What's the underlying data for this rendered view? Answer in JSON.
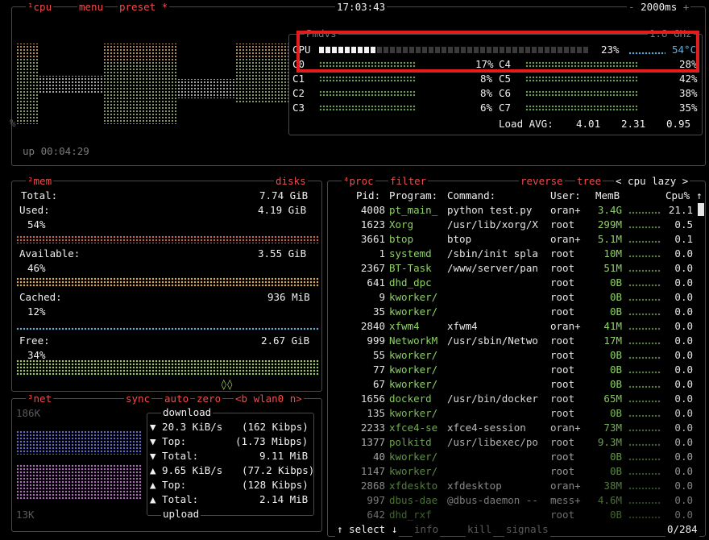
{
  "top": {
    "cpu_tag": "¹cpu",
    "menu": "menu",
    "preset": "preset *",
    "clock": "17:03:43",
    "interval": "2000ms",
    "minus": "-",
    "plus": "+"
  },
  "cpu": {
    "model": "Pmdvs",
    "freq": "1.8 GHz",
    "total_label": "CPU",
    "total_pct": "23%",
    "temp": "54°C",
    "cores": [
      {
        "name": "C0",
        "pct": "17%"
      },
      {
        "name": "C1",
        "pct": "8%"
      },
      {
        "name": "C2",
        "pct": "8%"
      },
      {
        "name": "C3",
        "pct": "6%"
      },
      {
        "name": "C4",
        "pct": "28%"
      },
      {
        "name": "C5",
        "pct": "42%"
      },
      {
        "name": "C6",
        "pct": "38%"
      },
      {
        "name": "C7",
        "pct": "35%"
      }
    ],
    "load_label": "Load AVG:",
    "load": [
      "4.01",
      "2.31",
      "0.95"
    ],
    "uptime": "up 00:04:29",
    "pct_marker": "%"
  },
  "mem": {
    "tag": "²mem",
    "disks": "disks",
    "total_label": "Total:",
    "total": "7.74 GiB",
    "used_label": "Used:",
    "used": "4.19 GiB",
    "used_pct": "54%",
    "avail_label": "Available:",
    "avail": "3.55 GiB",
    "avail_pct": "46%",
    "cached_label": "Cached:",
    "cached": "936 MiB",
    "cached_pct": "12%",
    "free_label": "Free:",
    "free": "2.67 GiB",
    "free_pct": "34%"
  },
  "net": {
    "tag": "³net",
    "sync": "sync",
    "auto": "auto",
    "zero": "zero",
    "iface": "<b wlan0 n>",
    "scale_top": "186K",
    "scale_bottom": "13K",
    "download": "download",
    "upload": "upload",
    "down_rate": "▼ 20.3 KiB/s",
    "down_rate_b": "(162 Kibps)",
    "down_top_l": "▼ Top:",
    "down_top": "(1.73 Mibps)",
    "down_total_l": "▼ Total:",
    "down_total": "9.11 MiB",
    "up_rate": "▲ 9.65 KiB/s",
    "up_rate_b": "(77.2 Kibps)",
    "up_top_l": "▲ Top:",
    "up_top": "(128 Kibps)",
    "up_total_l": "▲ Total:",
    "up_total": "2.14 MiB"
  },
  "proc": {
    "tag": "⁴proc",
    "filter": "filter",
    "reverse": "reverse",
    "tree": "tree",
    "sort": "< cpu lazy >",
    "headers": [
      "Pid:",
      "Program:",
      "Command:",
      "User:",
      "MemB",
      "Cpu%"
    ],
    "sort_arrow": "↑",
    "rows": [
      [
        "4008",
        "pt_main_",
        "python test.py",
        "oran+",
        "3.4G",
        "21.1"
      ],
      [
        "1623",
        "Xorg",
        "/usr/lib/xorg/X",
        "root",
        "299M",
        "0.5"
      ],
      [
        "3661",
        "btop",
        "btop",
        "oran+",
        "5.1M",
        "0.1"
      ],
      [
        "1",
        "systemd",
        "/sbin/init spla",
        "root",
        "10M",
        "0.0"
      ],
      [
        "2367",
        "BT-Task",
        "/www/server/pan",
        "root",
        "51M",
        "0.0"
      ],
      [
        "641",
        "dhd_dpc",
        "",
        "root",
        "0B",
        "0.0"
      ],
      [
        "9",
        "kworker/",
        "",
        "root",
        "0B",
        "0.0"
      ],
      [
        "35",
        "kworker/",
        "",
        "root",
        "0B",
        "0.0"
      ],
      [
        "2840",
        "xfwm4",
        "xfwm4",
        "oran+",
        "41M",
        "0.0"
      ],
      [
        "999",
        "NetworkM",
        "/usr/sbin/Netwo",
        "root",
        "17M",
        "0.0"
      ],
      [
        "55",
        "kworker/",
        "",
        "root",
        "0B",
        "0.0"
      ],
      [
        "77",
        "kworker/",
        "",
        "root",
        "0B",
        "0.0"
      ],
      [
        "67",
        "kworker/",
        "",
        "root",
        "0B",
        "0.0"
      ],
      [
        "1656",
        "dockerd",
        "/usr/bin/docker",
        "root",
        "65M",
        "0.0"
      ],
      [
        "135",
        "kworker/",
        "",
        "root",
        "0B",
        "0.0"
      ],
      [
        "2233",
        "xfce4-se",
        "xfce4-session",
        "oran+",
        "73M",
        "0.0"
      ],
      [
        "1377",
        "polkitd",
        "/usr/libexec/po",
        "root",
        "9.3M",
        "0.0"
      ],
      [
        "40",
        "kworker/",
        "",
        "root",
        "0B",
        "0.0"
      ],
      [
        "1147",
        "kworker/",
        "",
        "root",
        "0B",
        "0.0"
      ],
      [
        "2868",
        "xfdeskto",
        "xfdesktop",
        "oran+",
        "38M",
        "0.0"
      ],
      [
        "997",
        "dbus-dae",
        "@dbus-daemon --",
        "mess+",
        "4.6M",
        "0.0"
      ],
      [
        "642",
        "dhd_rxf",
        "",
        "root",
        "0B",
        "0.0"
      ]
    ],
    "footer": {
      "select": "↑ select ↓",
      "info": "info",
      "kill": "kill",
      "signals": "signals",
      "count": "0/284"
    }
  },
  "colors": {
    "highlight": "#e21d1d",
    "title": "#ee4d4d",
    "border": "#4a4a4a",
    "cpu_bar": "#7fd16a",
    "temp": "#58b4e8"
  }
}
